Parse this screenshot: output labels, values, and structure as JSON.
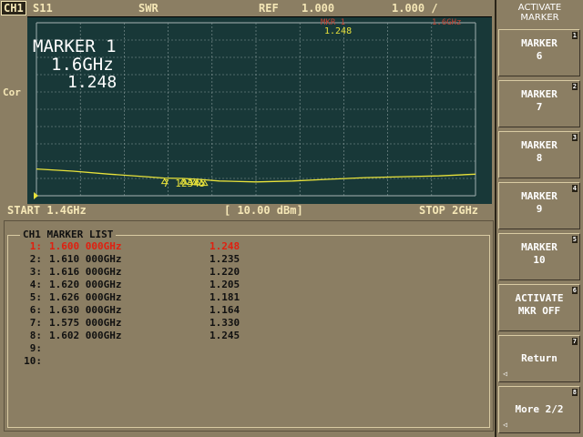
{
  "header": {
    "channel": "CH1",
    "param": "S11",
    "format": "SWR",
    "ref_label": "REF",
    "ref_value": "1.000",
    "scale": "1.000 /"
  },
  "screen": {
    "side_label": "Cor",
    "marker_title": "MARKER  1",
    "marker_freq": "1.6GHz",
    "marker_value": "1.248",
    "top_readout": "1.248",
    "top_readout_faint_left": "MKR  1",
    "top_readout_faint_right": "1.6GHz",
    "trace_markers_label": "7 12345",
    "start": "START 1.4GHz",
    "power": "[ 10.00 dBm]",
    "stop": "STOP 2GHz",
    "colors": {
      "screen_bg": "#183838",
      "grid": "#8a9c9c",
      "trace": "#e8e23a",
      "faint_readout": "#c04030"
    }
  },
  "chart_data": {
    "type": "line",
    "x_unit": "GHz",
    "xlim": [
      1.4,
      2.0
    ],
    "ylim": [
      0.0,
      10.0
    ],
    "x": [
      1.4,
      1.45,
      1.5,
      1.55,
      1.575,
      1.6,
      1.62,
      1.65,
      1.7,
      1.75,
      1.8,
      1.85,
      1.9,
      1.95,
      2.0
    ],
    "y": [
      1.55,
      1.42,
      1.25,
      1.1,
      1.02,
      1.0,
      0.95,
      0.85,
      0.8,
      0.85,
      0.95,
      1.05,
      1.1,
      1.15,
      1.25
    ],
    "grid": true
  },
  "marker_list": {
    "title": "CH1 MARKER LIST",
    "rows": [
      {
        "idx": "1:",
        "freq": "1.600 000GHz",
        "value": "1.248",
        "active": true
      },
      {
        "idx": "2:",
        "freq": "1.610 000GHz",
        "value": "1.235",
        "active": false
      },
      {
        "idx": "3:",
        "freq": "1.616 000GHz",
        "value": "1.220",
        "active": false
      },
      {
        "idx": "4:",
        "freq": "1.620 000GHz",
        "value": "1.205",
        "active": false
      },
      {
        "idx": "5:",
        "freq": "1.626 000GHz",
        "value": "1.181",
        "active": false
      },
      {
        "idx": "6:",
        "freq": "1.630 000GHz",
        "value": "1.164",
        "active": false
      },
      {
        "idx": "7:",
        "freq": "1.575 000GHz",
        "value": "1.330",
        "active": false
      },
      {
        "idx": "8:",
        "freq": "1.602 000GHz",
        "value": "1.245",
        "active": false
      },
      {
        "idx": "9:",
        "freq": "",
        "value": "",
        "active": false
      },
      {
        "idx": "10:",
        "freq": "",
        "value": "",
        "active": false
      }
    ]
  },
  "softkeys": {
    "title_line1": "ACTIVATE",
    "title_line2": "MARKER",
    "keys": [
      {
        "num": "1",
        "line1": "MARKER",
        "line2": "6"
      },
      {
        "num": "2",
        "line1": "MARKER",
        "line2": "7"
      },
      {
        "num": "3",
        "line1": "MARKER",
        "line2": "8"
      },
      {
        "num": "4",
        "line1": "MARKER",
        "line2": "9"
      },
      {
        "num": "5",
        "line1": "MARKER",
        "line2": "10"
      },
      {
        "num": "6",
        "line1": "ACTIVATE",
        "line2": "MKR OFF"
      },
      {
        "num": "7",
        "line1": "Return",
        "line2": ""
      },
      {
        "num": "8",
        "line1": "More 2/2",
        "line2": ""
      }
    ],
    "arrow_glyph": "◁"
  }
}
